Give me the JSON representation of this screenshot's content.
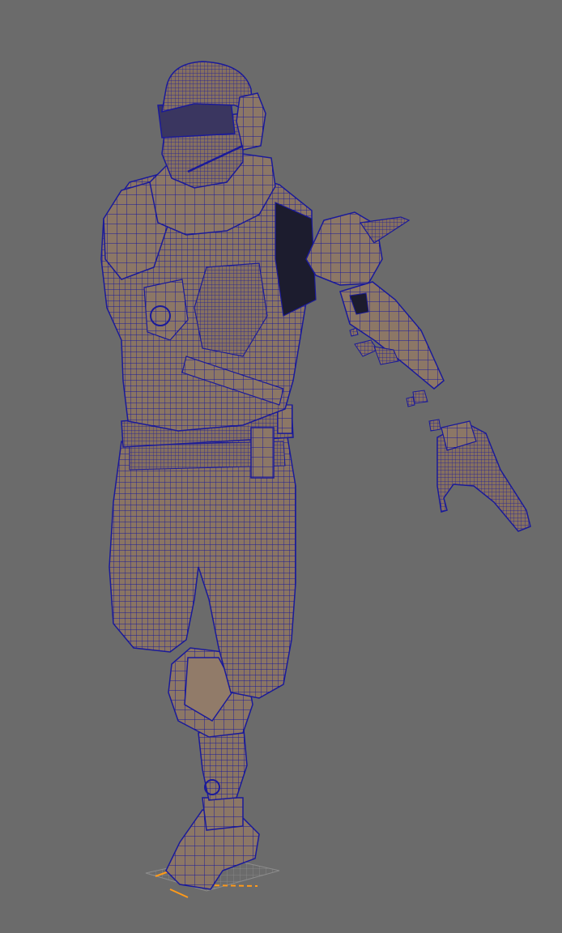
{
  "viewport": {
    "background_color": "#6b6b6b",
    "shading_color": "#8a7563",
    "shading_dark_color": "#5e4d40",
    "wireframe_color": "#1a1a9a",
    "selection_color": "#ff9a1a",
    "ground_grid_color": "#8c8c8c"
  },
  "model": {
    "parts": [
      {
        "name": "helmet"
      },
      {
        "name": "head"
      },
      {
        "name": "headset"
      },
      {
        "name": "neck-collar"
      },
      {
        "name": "torso-armor"
      },
      {
        "name": "left-shoulder-pad"
      },
      {
        "name": "right-upper-arm"
      },
      {
        "name": "right-forearm"
      },
      {
        "name": "right-hand"
      },
      {
        "name": "loose-fragments"
      },
      {
        "name": "belt"
      },
      {
        "name": "shorts"
      },
      {
        "name": "prosthetic-knee"
      },
      {
        "name": "prosthetic-shin"
      },
      {
        "name": "prosthetic-foot"
      },
      {
        "name": "ground-grid"
      }
    ]
  }
}
